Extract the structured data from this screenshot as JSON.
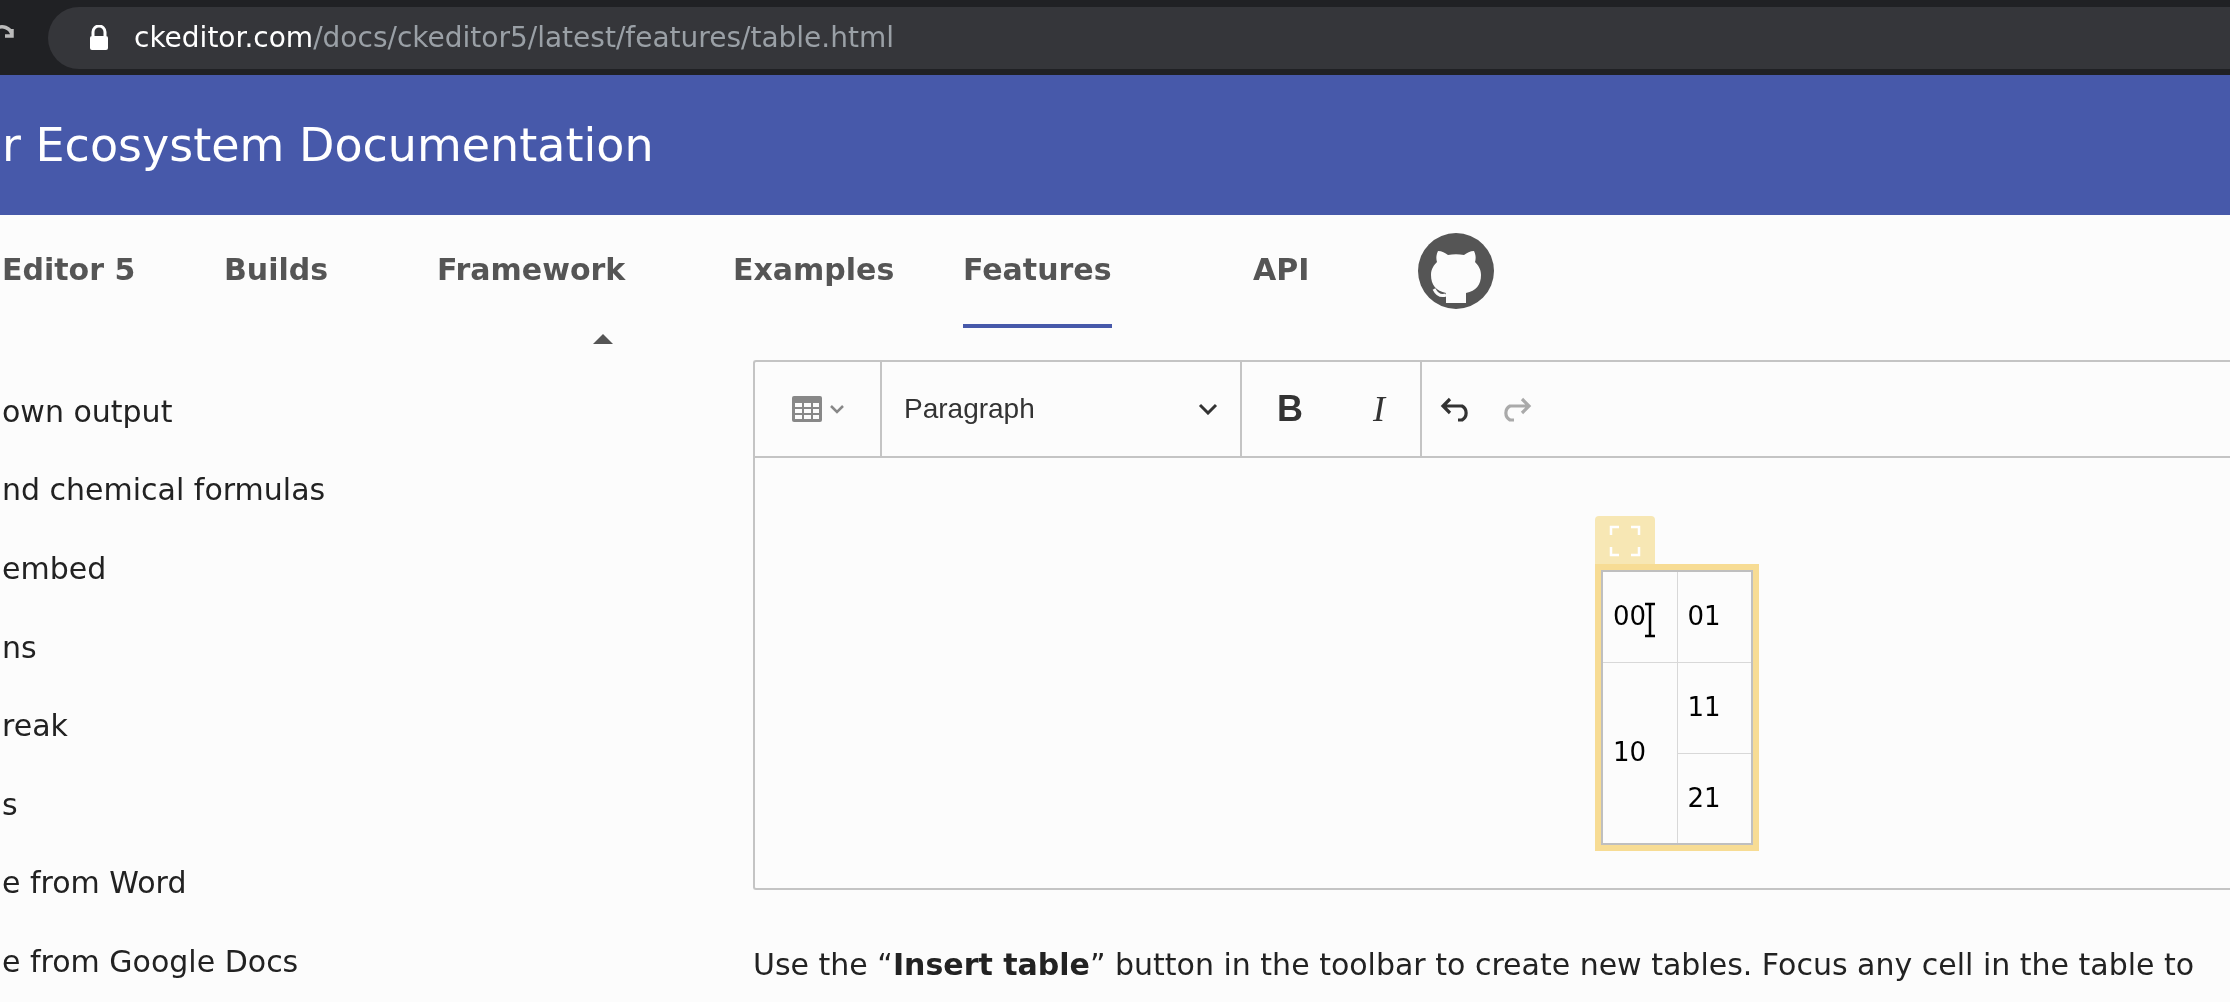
{
  "browser": {
    "url_host": "ckeditor.com",
    "url_path": "/docs/ckeditor5/latest/features/table.html"
  },
  "header": {
    "title": "r Ecosystem Documentation"
  },
  "nav": [
    {
      "label": "Editor 5",
      "selected": false
    },
    {
      "label": "Builds",
      "selected": false
    },
    {
      "label": "Framework",
      "selected": false
    },
    {
      "label": "Examples",
      "selected": false
    },
    {
      "label": "Features",
      "selected": true
    },
    {
      "label": "API",
      "selected": false
    }
  ],
  "sidebar": {
    "items": [
      "own output",
      "nd chemical formulas",
      "embed",
      "ns",
      "reak",
      "s",
      "e from Word",
      "e from Google Docs"
    ]
  },
  "editor": {
    "toolbar": {
      "heading": "Paragraph",
      "bold": "B",
      "italic": "I",
      "undo_enabled": true,
      "redo_enabled": false
    },
    "table": {
      "rows": [
        [
          {
            "text": "00"
          },
          {
            "text": "01"
          }
        ],
        [
          {
            "text": "10",
            "rowspan": 2
          },
          {
            "text": "11"
          }
        ],
        [
          {
            "text": "21"
          }
        ]
      ],
      "selected": true
    }
  },
  "paragraph": "Use the “**Insert table**” button in the toolbar to create new tables. Focus any cell in the table to"
}
